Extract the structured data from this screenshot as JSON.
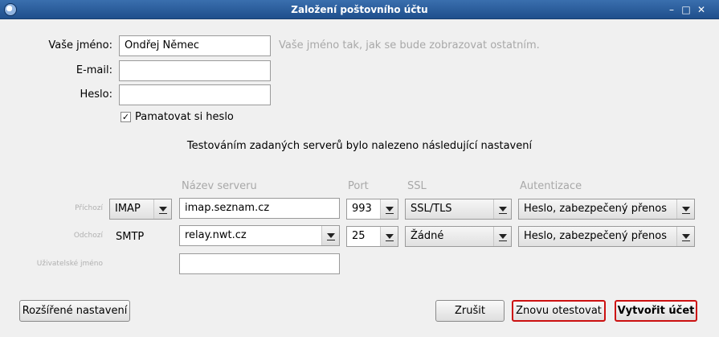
{
  "window": {
    "title": "Založení poštovního účtu",
    "controls": {
      "minimize": "–",
      "maximize": "□",
      "close": "✕"
    }
  },
  "form": {
    "name_label": "Vaše jméno:",
    "name_value": "Ondřej Němec",
    "name_hint": "Vaše jméno tak, jak se bude zobrazovat ostatním.",
    "email_label": "E-mail:",
    "email_value": "",
    "password_label": "Heslo:",
    "password_value": "",
    "remember_label": "Pamatovat si heslo",
    "remember_checked": "✓"
  },
  "message": "Testováním zadaných serverů bylo nalezeno následující nastavení",
  "servers": {
    "headers": {
      "server_name": "Název serveru",
      "port": "Port",
      "ssl": "SSL",
      "auth": "Autentizace"
    },
    "incoming": {
      "label": "Příchozí",
      "protocol": "IMAP",
      "server": "imap.seznam.cz",
      "port": "993",
      "ssl": "SSL/TLS",
      "auth": "Heslo, zabezpečený přenos"
    },
    "outgoing": {
      "label": "Odchozí",
      "protocol": "SMTP",
      "server": "relay.nwt.cz",
      "port": "25",
      "ssl": "Žádné",
      "auth": "Heslo, zabezpečený přenos"
    },
    "username_label": "Uživatelské jméno",
    "username_value": ""
  },
  "buttons": {
    "advanced": "Rozšířené nastavení",
    "cancel": "Zrušit",
    "retest": "Znovu otestovat",
    "create": "Vytvořit účet"
  }
}
